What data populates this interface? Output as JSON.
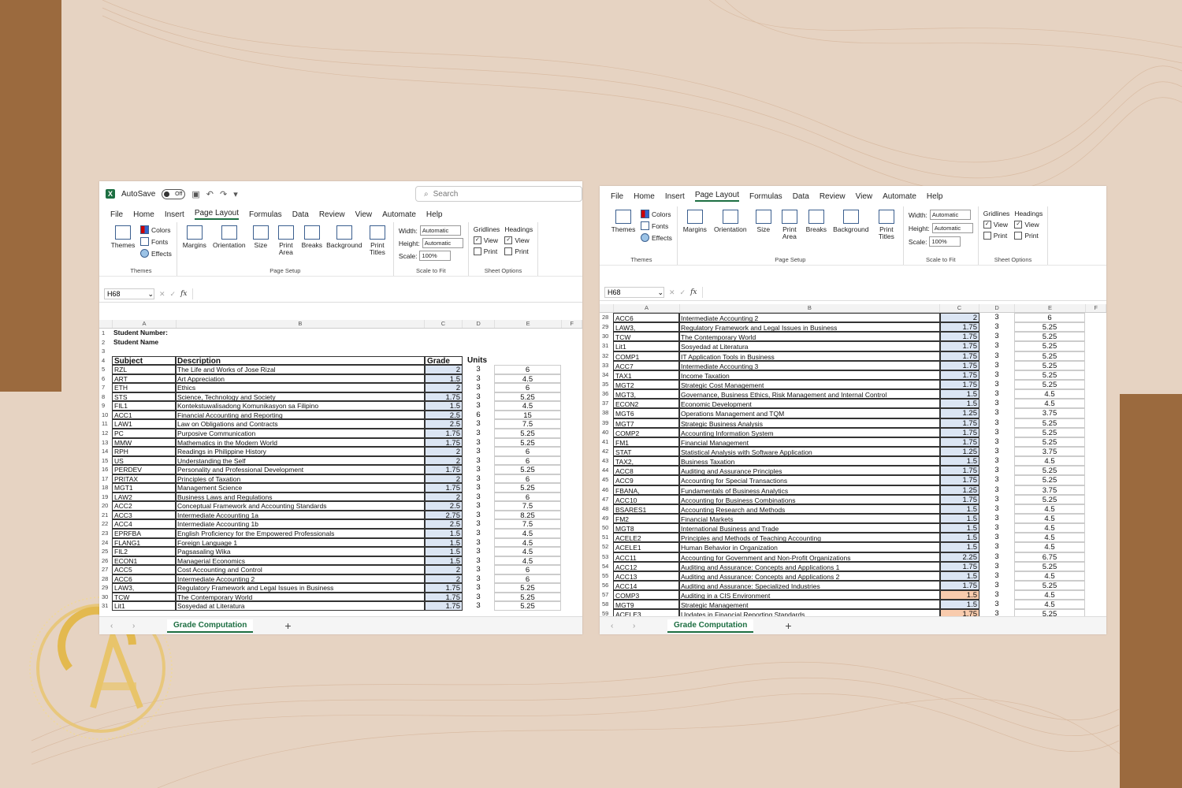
{
  "colors": {
    "background": "#e6d3c2",
    "accent_brown": "#9b6a3e",
    "excel_green": "#1d6f42",
    "grade_fill": "#dbe5f3",
    "highlight_fill": "#f8cbad"
  },
  "left_window": {
    "title_bar": {
      "autosave_label": "AutoSave",
      "toggle_state": "Off",
      "search_placeholder": "Search"
    },
    "menu": [
      "File",
      "Home",
      "Insert",
      "Page Layout",
      "Formulas",
      "Data",
      "Review",
      "View",
      "Automate",
      "Help"
    ],
    "active_tab": "Page Layout",
    "name_box": "H68",
    "columns": [
      "A",
      "B",
      "C",
      "D",
      "E",
      "F"
    ],
    "header_rows": [
      {
        "n": "1",
        "a": "Student Number:",
        "b": "",
        "c": "",
        "d": "",
        "e": ""
      },
      {
        "n": "2",
        "a": "Student Name",
        "b": "",
        "c": "",
        "d": "",
        "e": ""
      },
      {
        "n": "3",
        "a": "",
        "b": "",
        "c": "",
        "d": "",
        "e": ""
      },
      {
        "n": "4",
        "a": "Subject",
        "b": "Description",
        "c": "Grade",
        "d": "Units",
        "e": ""
      }
    ],
    "rows": [
      {
        "n": "5",
        "a": "RZL",
        "b": "The Life and Works of Jose Rizal",
        "c": "2",
        "d": "3",
        "e": "6"
      },
      {
        "n": "6",
        "a": "ART",
        "b": "Art Appreciation",
        "c": "1.5",
        "d": "3",
        "e": "4.5"
      },
      {
        "n": "7",
        "a": "ETH",
        "b": "Ethics",
        "c": "2",
        "d": "3",
        "e": "6"
      },
      {
        "n": "8",
        "a": "STS",
        "b": "Science, Technology and Society",
        "c": "1.75",
        "d": "3",
        "e": "5.25"
      },
      {
        "n": "9",
        "a": "FIL1",
        "b": "Kontekstuwalisadong Komunikasyon sa Filipino",
        "c": "1.5",
        "d": "3",
        "e": "4.5"
      },
      {
        "n": "10",
        "a": "ACC1",
        "b": "Financial Accounting and Reporting",
        "c": "2.5",
        "d": "6",
        "e": "15"
      },
      {
        "n": "11",
        "a": "LAW1",
        "b": "Law on Obligations and Contracts",
        "c": "2.5",
        "d": "3",
        "e": "7.5"
      },
      {
        "n": "12",
        "a": "PC",
        "b": "Purposive Communication",
        "c": "1.75",
        "d": "3",
        "e": "5.25"
      },
      {
        "n": "13",
        "a": "MMW",
        "b": "Mathematics in the Modern World",
        "c": "1.75",
        "d": "3",
        "e": "5.25"
      },
      {
        "n": "14",
        "a": "RPH",
        "b": "Readings in Philippine History",
        "c": "2",
        "d": "3",
        "e": "6"
      },
      {
        "n": "15",
        "a": "US",
        "b": "Understanding the Self",
        "c": "2",
        "d": "3",
        "e": "6"
      },
      {
        "n": "16",
        "a": "PERDEV",
        "b": "Personality and Professional Development",
        "c": "1.75",
        "d": "3",
        "e": "5.25"
      },
      {
        "n": "17",
        "a": "PRITAX",
        "b": "Principles of Taxation",
        "c": "2",
        "d": "3",
        "e": "6"
      },
      {
        "n": "18",
        "a": "MGT1",
        "b": "Management Science",
        "c": "1.75",
        "d": "3",
        "e": "5.25"
      },
      {
        "n": "19",
        "a": "LAW2",
        "b": "Business Laws and Regulations",
        "c": "2",
        "d": "3",
        "e": "6"
      },
      {
        "n": "20",
        "a": "ACC2",
        "b": "Conceptual Framework and Accounting Standards",
        "c": "2.5",
        "d": "3",
        "e": "7.5"
      },
      {
        "n": "21",
        "a": "ACC3",
        "b": "Intermediate Accounting 1a",
        "c": "2.75",
        "d": "3",
        "e": "8.25"
      },
      {
        "n": "22",
        "a": "ACC4",
        "b": "Intermediate Accounting 1b",
        "c": "2.5",
        "d": "3",
        "e": "7.5"
      },
      {
        "n": "23",
        "a": "EPRFBA",
        "b": "English Proficiency for the Empowered Professionals",
        "c": "1.5",
        "d": "3",
        "e": "4.5"
      },
      {
        "n": "24",
        "a": "FLANG1",
        "b": "Foreign Language 1",
        "c": "1.5",
        "d": "3",
        "e": "4.5"
      },
      {
        "n": "25",
        "a": "FIL2",
        "b": "Pagsasaling Wika",
        "c": "1.5",
        "d": "3",
        "e": "4.5"
      },
      {
        "n": "26",
        "a": "ECON1",
        "b": "Managerial Economics",
        "c": "1.5",
        "d": "3",
        "e": "4.5"
      },
      {
        "n": "27",
        "a": "ACC5",
        "b": "Cost Accounting and Control",
        "c": "2",
        "d": "3",
        "e": "6"
      },
      {
        "n": "28",
        "a": "ACC6",
        "b": "Intermediate Accounting 2",
        "c": "2",
        "d": "3",
        "e": "6"
      },
      {
        "n": "29",
        "a": "LAW3,",
        "b": "Regulatory Framework and Legal Issues in Business",
        "c": "1.75",
        "d": "3",
        "e": "5.25"
      },
      {
        "n": "30",
        "a": "TCW",
        "b": "The Contemporary World",
        "c": "1.75",
        "d": "3",
        "e": "5.25"
      },
      {
        "n": "31",
        "a": "Lit1",
        "b": "Sosyedad at Literatura",
        "c": "1.75",
        "d": "3",
        "e": "5.25"
      }
    ],
    "sheet_tab": "Grade Computation"
  },
  "right_window": {
    "menu": [
      "File",
      "Home",
      "Insert",
      "Page Layout",
      "Formulas",
      "Data",
      "Review",
      "View",
      "Automate",
      "Help"
    ],
    "active_tab": "Page Layout",
    "name_box": "H68",
    "columns": [
      "A",
      "B",
      "C",
      "D",
      "E",
      "F"
    ],
    "rows": [
      {
        "n": "28",
        "a": "ACC6",
        "b": "Intermediate Accounting 2",
        "c": "2",
        "d": "3",
        "e": "6"
      },
      {
        "n": "29",
        "a": "LAW3,",
        "b": "Regulatory Framework and Legal Issues in Business",
        "c": "1.75",
        "d": "3",
        "e": "5.25"
      },
      {
        "n": "30",
        "a": "TCW",
        "b": "The Contemporary World",
        "c": "1.75",
        "d": "3",
        "e": "5.25"
      },
      {
        "n": "31",
        "a": "Lit1",
        "b": "Sosyedad at Literatura",
        "c": "1.75",
        "d": "3",
        "e": "5.25"
      },
      {
        "n": "32",
        "a": "COMP1",
        "b": "IT Application Tools in Business",
        "c": "1.75",
        "d": "3",
        "e": "5.25"
      },
      {
        "n": "33",
        "a": "ACC7",
        "b": "Intermediate Accounting 3",
        "c": "1.75",
        "d": "3",
        "e": "5.25"
      },
      {
        "n": "34",
        "a": "TAX1",
        "b": "Income Taxation",
        "c": "1.75",
        "d": "3",
        "e": "5.25"
      },
      {
        "n": "35",
        "a": "MGT2",
        "b": "Strategic Cost Management",
        "c": "1.75",
        "d": "3",
        "e": "5.25"
      },
      {
        "n": "36",
        "a": "MGT3,",
        "b": "Governance, Business Ethics, Risk Management and Internal Control",
        "c": "1.5",
        "d": "3",
        "e": "4.5"
      },
      {
        "n": "37",
        "a": "ECON2",
        "b": "Economic Development",
        "c": "1.5",
        "d": "3",
        "e": "4.5"
      },
      {
        "n": "38",
        "a": "MGT6",
        "b": "Operations Management and TQM",
        "c": "1.25",
        "d": "3",
        "e": "3.75"
      },
      {
        "n": "39",
        "a": "MGT7",
        "b": "Strategic Business Analysis",
        "c": "1.75",
        "d": "3",
        "e": "5.25"
      },
      {
        "n": "40",
        "a": "COMP2",
        "b": "Accounting Information System",
        "c": "1.75",
        "d": "3",
        "e": "5.25"
      },
      {
        "n": "41",
        "a": "FM1",
        "b": "Financial Management",
        "c": "1.75",
        "d": "3",
        "e": "5.25"
      },
      {
        "n": "42",
        "a": "STAT",
        "b": "Statistical Analysis with Software Application",
        "c": "1.25",
        "d": "3",
        "e": "3.75"
      },
      {
        "n": "43",
        "a": "TAX2,",
        "b": "Business Taxation",
        "c": "1.5",
        "d": "3",
        "e": "4.5"
      },
      {
        "n": "44",
        "a": "ACC8",
        "b": "Auditing and Assurance Principles",
        "c": "1.75",
        "d": "3",
        "e": "5.25"
      },
      {
        "n": "45",
        "a": "ACC9",
        "b": "Accounting for Special Transactions",
        "c": "1.75",
        "d": "3",
        "e": "5.25"
      },
      {
        "n": "46",
        "a": "FBANA,",
        "b": "Fundamentals of Business Analytics",
        "c": "1.25",
        "d": "3",
        "e": "3.75"
      },
      {
        "n": "47",
        "a": "ACC10",
        "b": "Accounting for Business Combinations",
        "c": "1.75",
        "d": "3",
        "e": "5.25"
      },
      {
        "n": "48",
        "a": "BSARES1",
        "b": "Accounting Research and Methods",
        "c": "1.5",
        "d": "3",
        "e": "4.5"
      },
      {
        "n": "49",
        "a": "FM2",
        "b": "Financial Markets",
        "c": "1.5",
        "d": "3",
        "e": "4.5"
      },
      {
        "n": "50",
        "a": "MGT8",
        "b": "International Business and Trade",
        "c": "1.5",
        "d": "3",
        "e": "4.5"
      },
      {
        "n": "51",
        "a": "ACELE2",
        "b": "Principles and Methods of Teaching Accounting",
        "c": "1.5",
        "d": "3",
        "e": "4.5"
      },
      {
        "n": "52",
        "a": "ACELE1",
        "b": "Human Behavior in Organization",
        "c": "1.5",
        "d": "3",
        "e": "4.5"
      },
      {
        "n": "53",
        "a": "ACC11",
        "b": "Accounting for Government and Non-Profit Organizations",
        "c": "2.25",
        "d": "3",
        "e": "6.75"
      },
      {
        "n": "54",
        "a": "ACC12",
        "b": "Auditing and Assurance: Concepts and Applications 1",
        "c": "1.75",
        "d": "3",
        "e": "5.25"
      },
      {
        "n": "55",
        "a": "ACC13",
        "b": "Auditing and Assurance: Concepts and Applications 2",
        "c": "1.5",
        "d": "3",
        "e": "4.5"
      },
      {
        "n": "56",
        "a": "ACC14",
        "b": "Auditing and Assurance: Specialized Industries",
        "c": "1.75",
        "d": "3",
        "e": "5.25"
      },
      {
        "n": "57",
        "a": "COMP3",
        "b": "Auditing in a CIS Environment",
        "c": "1.5",
        "d": "3",
        "e": "4.5",
        "hl": true
      },
      {
        "n": "58",
        "a": "MGT9",
        "b": "Strategic Management",
        "c": "1.5",
        "d": "3",
        "e": "4.5"
      },
      {
        "n": "59",
        "a": "ACELE3",
        "b": "Updates in Financial Reporting Standards",
        "c": "1.75",
        "d": "3",
        "e": "5.25",
        "hl": true
      }
    ],
    "sheet_tab": "Grade Computation"
  },
  "ribbon": {
    "themes": {
      "themes": "Themes",
      "colors": "Colors",
      "fonts": "Fonts",
      "effects": "Effects",
      "label": "Themes"
    },
    "page_setup": {
      "margins": "Margins",
      "orientation": "Orientation",
      "size": "Size",
      "print_area": "Print Area",
      "breaks": "Breaks",
      "background": "Background",
      "print_titles": "Print Titles",
      "label": "Page Setup"
    },
    "scale": {
      "width": "Width:",
      "height": "Height:",
      "scale": "Scale:",
      "auto": "Automatic",
      "pct": "100%",
      "label": "Scale to Fit"
    },
    "sheet_options": {
      "gridlines": "Gridlines",
      "headings": "Headings",
      "view": "View",
      "print": "Print",
      "label": "Sheet Options"
    }
  }
}
